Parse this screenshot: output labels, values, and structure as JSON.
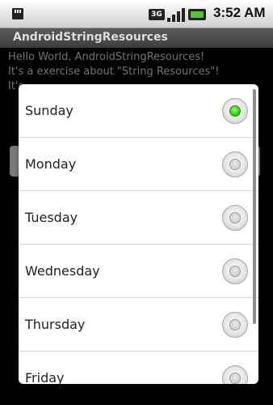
{
  "status_bar": {
    "network_label": "3G",
    "time": "3:52 AM"
  },
  "app": {
    "title": "AndroidStringResources"
  },
  "content": {
    "line1": "Hello World, AndroidStringResources!",
    "line2": "It's a exercise about \"String Resources\"!",
    "line3_partial": "It's"
  },
  "dialog": {
    "items": [
      {
        "label": "Sunday",
        "checked": true
      },
      {
        "label": "Monday",
        "checked": false
      },
      {
        "label": "Tuesday",
        "checked": false
      },
      {
        "label": "Wednesday",
        "checked": false
      },
      {
        "label": "Thursday",
        "checked": false
      },
      {
        "label": "Friday",
        "checked": false
      }
    ]
  },
  "colors": {
    "accent_checked": "#3fcf1f",
    "battery": "#59c12d",
    "title_bar": "#4a4a4a"
  }
}
